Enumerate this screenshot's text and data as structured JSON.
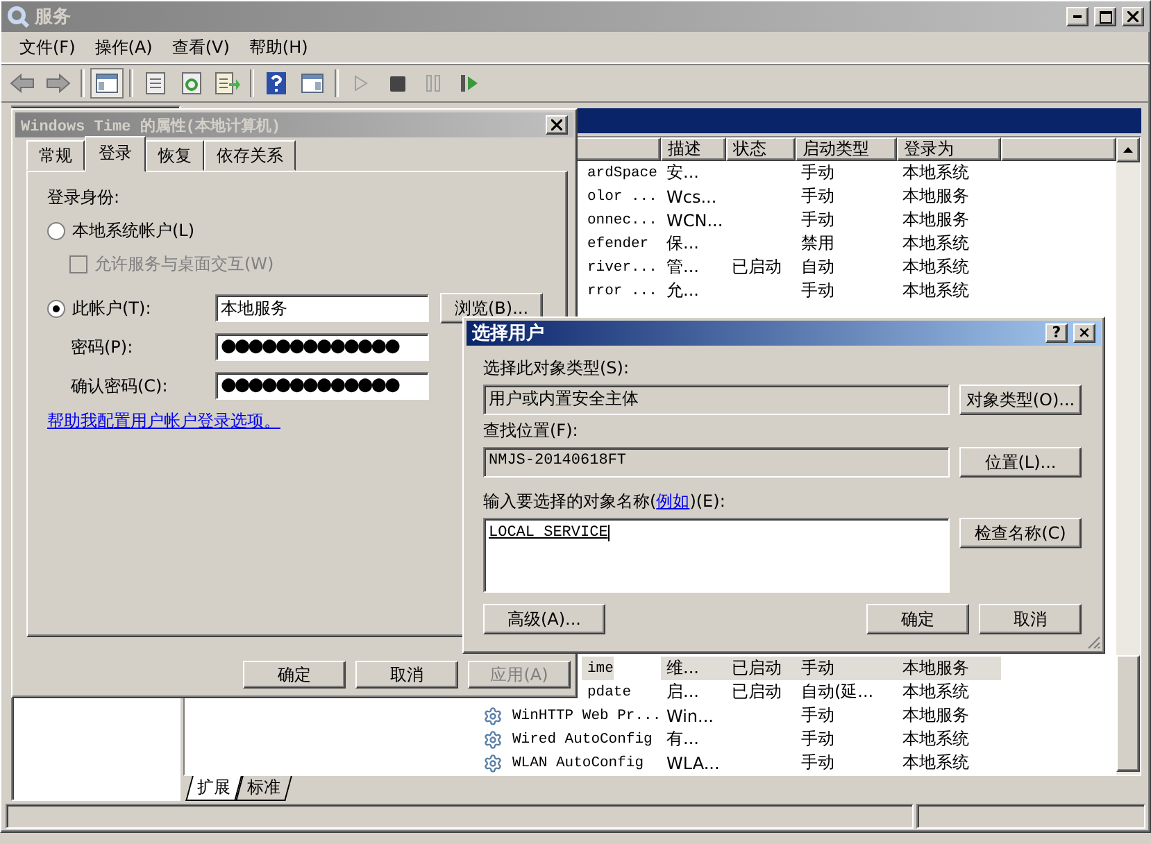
{
  "window": {
    "title": "服务"
  },
  "menu": [
    "文件(F)",
    "操作(A)",
    "查看(V)",
    "帮助(H)"
  ],
  "toolbar": [
    {
      "kind": "back"
    },
    {
      "kind": "forward"
    },
    {
      "kind": "separator"
    },
    {
      "kind": "tree",
      "pressed": true
    },
    {
      "kind": "separator"
    },
    {
      "kind": "properties"
    },
    {
      "kind": "refresh"
    },
    {
      "kind": "export"
    },
    {
      "kind": "separator"
    },
    {
      "kind": "help"
    },
    {
      "kind": "pane"
    },
    {
      "kind": "separator"
    },
    {
      "kind": "start",
      "disabled": true
    },
    {
      "kind": "stop",
      "disabled": false
    },
    {
      "kind": "pause",
      "disabled": true
    },
    {
      "kind": "restart",
      "disabled": false
    }
  ],
  "services": {
    "columns": [
      "描述",
      "状态",
      "启动类型",
      "登录为"
    ],
    "rows_top": [
      {
        "kind": "partial",
        "name": "ardSpace",
        "description": "安...",
        "startup": "手动",
        "logon": "本地系统",
        "selected": false
      },
      {
        "kind": "partial",
        "name": "olor ...",
        "description": "Wcs...",
        "startup": "手动",
        "logon": "本地服务",
        "selected": false
      },
      {
        "kind": "partial",
        "name": "onnec...",
        "description": "WCN...",
        "startup": "手动",
        "logon": "本地服务",
        "selected": false
      },
      {
        "kind": "partial",
        "name": "efender",
        "description": "保...",
        "startup": "禁用",
        "logon": "本地系统",
        "selected": false
      },
      {
        "kind": "partial",
        "name": "river...",
        "description": "管...",
        "status": "已启动",
        "startup": "自动",
        "logon": "本地系统",
        "selected": false
      },
      {
        "kind": "partial",
        "name": "rror ...",
        "description": "允...",
        "startup": "手动",
        "logon": "本地系统",
        "selected": false
      }
    ],
    "rows_bottom": [
      {
        "kind": "partial",
        "name": "ime",
        "description": "维...",
        "status": "已启动",
        "startup": "手动",
        "logon": "本地服务",
        "selected": true
      },
      {
        "kind": "partial",
        "name": "pdate",
        "description": "启...",
        "status": "已启动",
        "startup": "自动(延...",
        "logon": "本地系统",
        "selected": false
      },
      {
        "kind": "full",
        "name": "WinHTTP Web Pr...",
        "description": "Win...",
        "startup": "手动",
        "logon": "本地服务",
        "selected": false
      },
      {
        "kind": "full",
        "name": "Wired AutoConfig",
        "description": "有...",
        "startup": "手动",
        "logon": "本地系统",
        "selected": false
      },
      {
        "kind": "full",
        "name": "WLAN AutoConfig",
        "description": "WLA...",
        "startup": "手动",
        "logon": "本地系统",
        "selected": false
      }
    ]
  },
  "bottom_tabs": [
    {
      "label": "扩展",
      "selected": true
    },
    {
      "label": "标准",
      "selected": false
    }
  ],
  "properties_dialog": {
    "title": "Windows Time 的属性(本地计算机)",
    "tabs": [
      {
        "label": "常规",
        "selected": false
      },
      {
        "label": "登录",
        "selected": true
      },
      {
        "label": "恢复",
        "selected": false
      },
      {
        "label": "依存关系",
        "selected": false
      }
    ],
    "logon_as_label": "登录身份:",
    "local_system": {
      "label": "本地系统帐户(L)",
      "selected": false
    },
    "desktop_interact": {
      "label": "允许服务与桌面交互(W)",
      "checked": false,
      "disabled": true
    },
    "this_account": {
      "label": "此帐户(T):",
      "selected": true,
      "value": "本地服务",
      "browse": "浏览(B)..."
    },
    "password": {
      "label": "密码(P):",
      "value": "●●●●●●●●●●●●●"
    },
    "confirm_password": {
      "label": "确认密码(C):",
      "value": "●●●●●●●●●●●●●"
    },
    "help_link": "帮助我配置用户帐户登录选项。",
    "buttons": [
      {
        "label": "确定",
        "disabled": false
      },
      {
        "label": "取消",
        "disabled": false
      },
      {
        "label": "应用(A)",
        "disabled": true
      }
    ]
  },
  "select_user_dialog": {
    "title": "选择用户",
    "help": "?",
    "close": "×",
    "object_type_label": "选择此对象类型(S):",
    "object_type": "用户或内置安全主体",
    "object_type_button": "对象类型(O)...",
    "location_label": "查找位置(F):",
    "location": "NMJS-20140618FT",
    "location_button": "位置(L)...",
    "names_label_before": "输入要选择的对象名称(",
    "names_link": "例如",
    "names_label_after": ")(E):",
    "names_value": "LOCAL SERVICE",
    "check_names_button": "检查名称(C)",
    "advanced_button": "高级(A)...",
    "ok_button": "确定",
    "cancel_button": "取消"
  }
}
